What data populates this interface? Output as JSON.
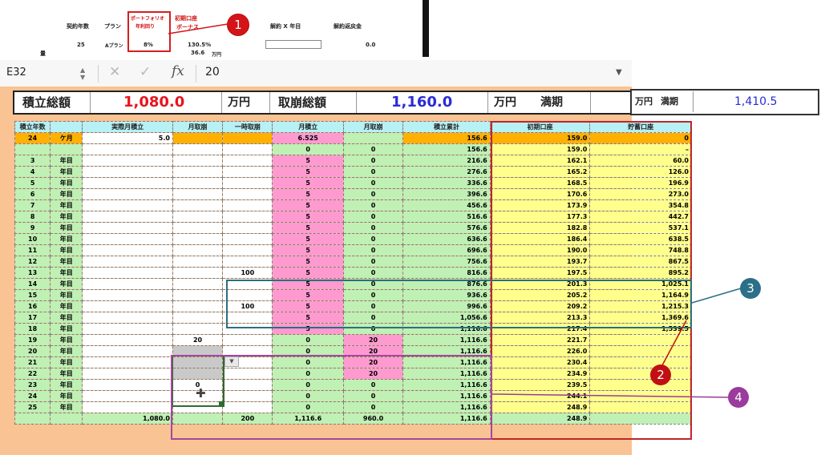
{
  "snippet": {
    "contract_years_label": "契約年数",
    "plan_label": "プラン",
    "rate_label_1": "ポートフォリオ",
    "rate_label_2": "年利回り",
    "bonus_label_1": "初期口座",
    "bonus_label_2": "ボーナス",
    "cancel_label": "解約 X 年目",
    "refund_label": "解約返戻金",
    "contract_years": "25",
    "plan": "Aプラン",
    "rate": "8%",
    "bonus": "130.5%",
    "sub_value": "36.6",
    "sub_unit": "万円",
    "refund": "0.0",
    "side_mark": "量"
  },
  "formula_bar": {
    "name_box": "E32",
    "stepper": "▲\n▼",
    "cancel_icon": "✕",
    "enter_icon": "✓",
    "fx_icon": "fx",
    "formula": "20",
    "dropdown": "▼"
  },
  "summary": {
    "total_savings_label": "積立総額",
    "total_savings": "1,080.0",
    "unit1": "万円",
    "total_withdraw_label": "取崩総額",
    "total_withdraw": "1,160.0",
    "unit2": "万円",
    "maturity_label": "満期",
    "right_unit": "万円",
    "right_label": "満期",
    "right_value": "1,410.5"
  },
  "colors": {
    "red_value": "#e8141e",
    "blue_value": "#2b2bd6",
    "badge_red": "#d41418",
    "badge_blue": "#2c6f88",
    "badge_purple": "#9a3b9d"
  },
  "table": {
    "headers": [
      "積立年数",
      "",
      "実際月積立",
      "月取崩",
      "一時取崩",
      "月積立",
      "月取崩",
      "積立累計",
      "初期口座",
      "貯蓄口座"
    ],
    "row0": [
      "24",
      "ケ月",
      "5.0",
      "",
      "",
      "6.525",
      "",
      "156.6",
      "159.0",
      "0"
    ],
    "rows": [
      [
        "",
        "",
        "",
        "",
        "",
        "0",
        "0",
        "156.6",
        "159.0",
        "–"
      ],
      [
        "3",
        "年目",
        "",
        "",
        "",
        "5",
        "0",
        "216.6",
        "162.1",
        "60.0"
      ],
      [
        "4",
        "年目",
        "",
        "",
        "",
        "5",
        "0",
        "276.6",
        "165.2",
        "126.0"
      ],
      [
        "5",
        "年目",
        "",
        "",
        "",
        "5",
        "0",
        "336.6",
        "168.5",
        "196.9"
      ],
      [
        "6",
        "年目",
        "",
        "",
        "",
        "5",
        "0",
        "396.6",
        "170.6",
        "273.0"
      ],
      [
        "7",
        "年目",
        "",
        "",
        "",
        "5",
        "0",
        "456.6",
        "173.9",
        "354.8"
      ],
      [
        "8",
        "年目",
        "",
        "",
        "",
        "5",
        "0",
        "516.6",
        "177.3",
        "442.7"
      ],
      [
        "9",
        "年目",
        "",
        "",
        "",
        "5",
        "0",
        "576.6",
        "182.8",
        "537.1"
      ],
      [
        "10",
        "年目",
        "",
        "",
        "",
        "5",
        "0",
        "636.6",
        "186.4",
        "638.5"
      ],
      [
        "11",
        "年目",
        "",
        "",
        "",
        "5",
        "0",
        "696.6",
        "190.0",
        "748.8"
      ],
      [
        "12",
        "年目",
        "",
        "",
        "",
        "5",
        "0",
        "756.6",
        "193.7",
        "867.5"
      ],
      [
        "13",
        "年目",
        "",
        "",
        "100",
        "5",
        "0",
        "816.6",
        "197.5",
        "895.2"
      ],
      [
        "14",
        "年目",
        "",
        "",
        "",
        "5",
        "0",
        "876.6",
        "201.3",
        "1,025.1"
      ],
      [
        "15",
        "年目",
        "",
        "",
        "",
        "5",
        "0",
        "936.6",
        "205.2",
        "1,164.9"
      ],
      [
        "16",
        "年目",
        "",
        "",
        "100",
        "5",
        "0",
        "996.6",
        "209.2",
        "1,215.3"
      ],
      [
        "17",
        "年目",
        "",
        "",
        "",
        "5",
        "0",
        "1,056.6",
        "213.3",
        "1,369.6"
      ],
      [
        "18",
        "年目",
        "",
        "",
        "",
        "5",
        "0",
        "1,116.6",
        "217.4",
        "1,539.5"
      ],
      [
        "19",
        "年目",
        "",
        "20",
        "",
        "0",
        "20",
        "1,116.6",
        "221.7",
        ""
      ],
      [
        "20",
        "年目",
        "",
        "",
        "",
        "0",
        "20",
        "1,116.6",
        "226.0",
        ""
      ],
      [
        "21",
        "年目",
        "",
        "",
        "",
        "0",
        "20",
        "1,116.6",
        "230.4",
        ""
      ],
      [
        "22",
        "年目",
        "",
        "",
        "",
        "0",
        "20",
        "1,116.6",
        "234.9",
        ""
      ],
      [
        "23",
        "年目",
        "",
        "0",
        "",
        "0",
        "0",
        "1,116.6",
        "239.5",
        ""
      ],
      [
        "24",
        "年目",
        "",
        "",
        "",
        "0",
        "0",
        "1,116.6",
        "244.1",
        ""
      ],
      [
        "25",
        "年目",
        "",
        "",
        "",
        "0",
        "0",
        "1,116.6",
        "248.9",
        ""
      ]
    ],
    "totals": [
      "",
      "",
      "1,080.0",
      "",
      "200",
      "1,116.6",
      "960.0",
      "1,116.6",
      "248.9",
      ""
    ]
  },
  "badges": {
    "b1": "1",
    "b2": "2",
    "b3": "3",
    "b4": "4"
  }
}
